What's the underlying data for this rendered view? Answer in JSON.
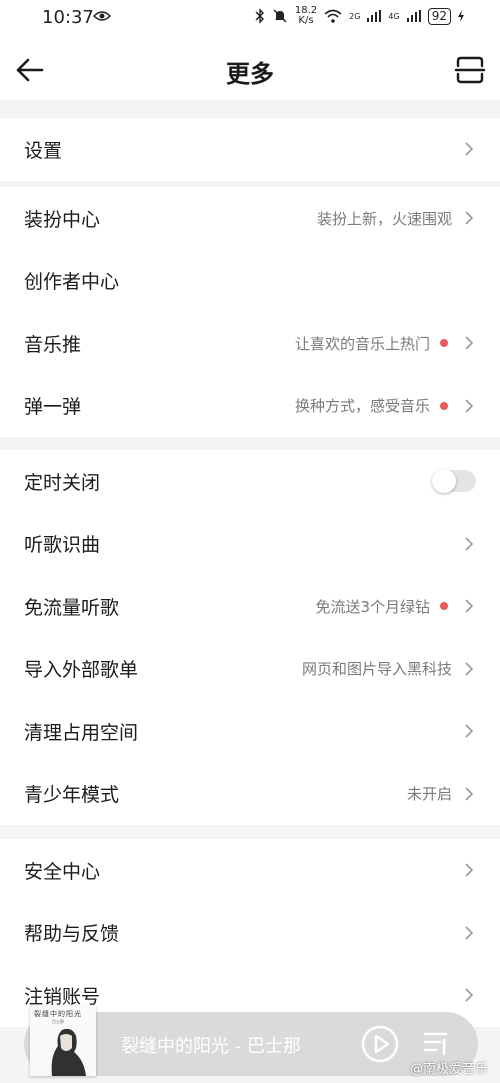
{
  "status_bar": {
    "time": "10:37",
    "net_speed_value": "18.2",
    "net_speed_unit": "K/s",
    "signal_1_label": "2G",
    "signal_2_label": "4G",
    "battery": "92"
  },
  "header": {
    "title": "更多"
  },
  "groups": [
    {
      "rows": [
        {
          "label": "设置",
          "sub": "",
          "dot": false,
          "control": "chevron"
        }
      ]
    },
    {
      "rows": [
        {
          "label": "装扮中心",
          "sub": "装扮上新，火速围观",
          "dot": false,
          "control": "chevron"
        },
        {
          "label": "创作者中心",
          "sub": "",
          "dot": false,
          "control": "none"
        },
        {
          "label": "音乐推",
          "sub": "让喜欢的音乐上热门",
          "dot": true,
          "control": "chevron"
        },
        {
          "label": "弹一弹",
          "sub": "换种方式，感受音乐",
          "dot": true,
          "control": "chevron"
        }
      ]
    },
    {
      "rows": [
        {
          "label": "定时关闭",
          "sub": "",
          "dot": false,
          "control": "toggle",
          "on": false
        },
        {
          "label": "听歌识曲",
          "sub": "",
          "dot": false,
          "control": "chevron"
        },
        {
          "label": "免流量听歌",
          "sub": "免流送3个月绿钻",
          "dot": true,
          "control": "chevron"
        },
        {
          "label": "导入外部歌单",
          "sub": "网页和图片导入黑科技",
          "dot": false,
          "control": "chevron"
        },
        {
          "label": "清理占用空间",
          "sub": "",
          "dot": false,
          "control": "chevron"
        },
        {
          "label": "青少年模式",
          "sub": "未开启",
          "dot": false,
          "control": "chevron"
        }
      ]
    },
    {
      "rows": [
        {
          "label": "安全中心",
          "sub": "",
          "dot": false,
          "control": "chevron"
        },
        {
          "label": "帮助与反馈",
          "sub": "",
          "dot": false,
          "control": "chevron"
        },
        {
          "label": "注销账号",
          "sub": "",
          "dot": false,
          "control": "chevron"
        }
      ]
    }
  ],
  "player": {
    "album_title": "裂缝中的阳光",
    "album_artist": "巴士那",
    "now_playing": "裂缝中的阳光 - 巴士那"
  },
  "watermark": "@南极爱音乐",
  "colors": {
    "red_dot": "#e85a5a",
    "background": "#f4f4f4"
  }
}
